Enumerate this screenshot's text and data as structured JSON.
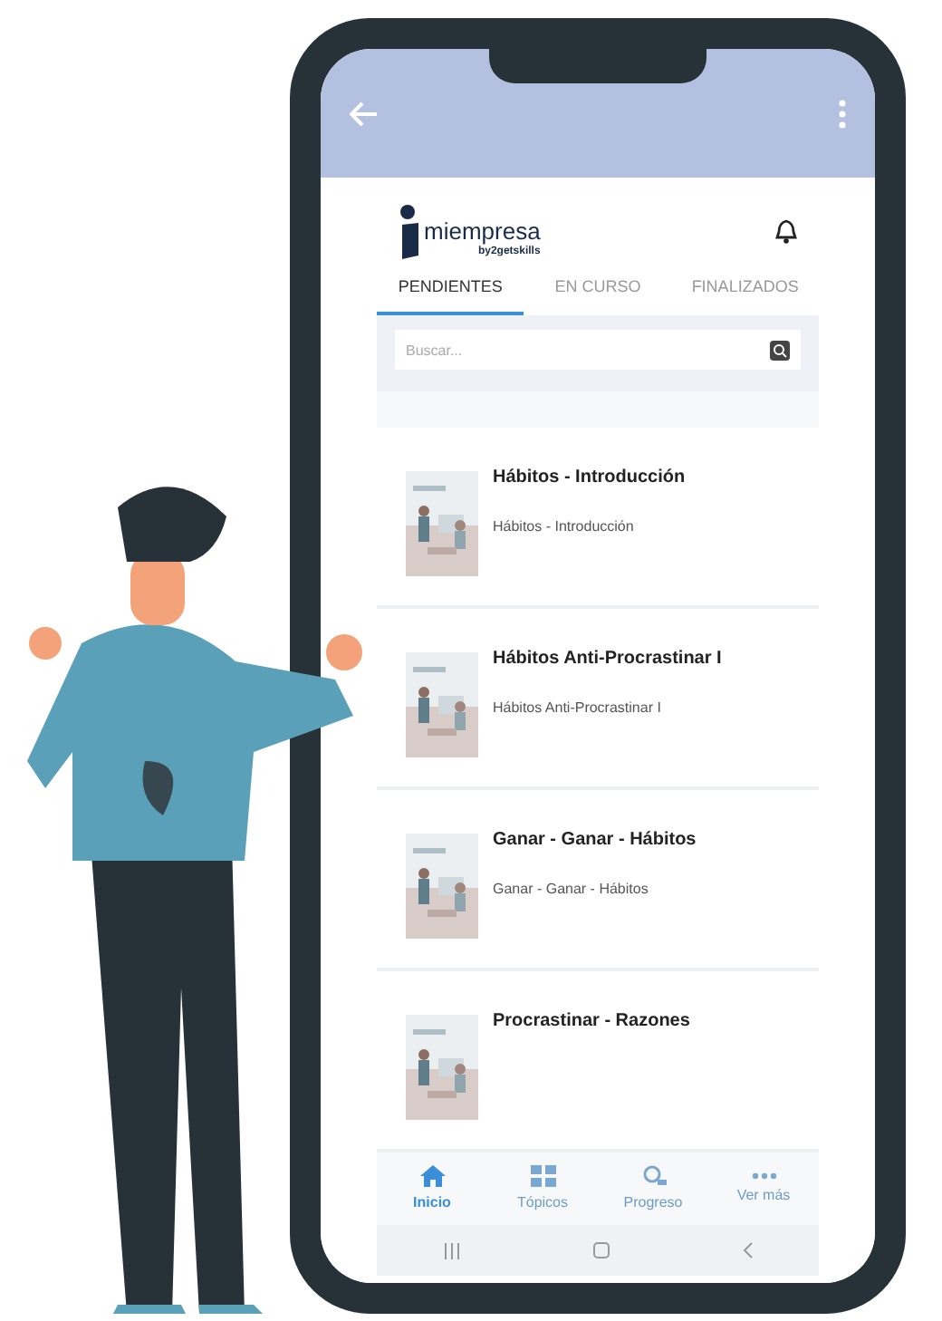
{
  "app": {
    "logo": {
      "name": "miempresa",
      "byline": "by2getskills"
    },
    "tabs": [
      {
        "label": "PENDIENTES",
        "selected": true
      },
      {
        "label": "EN CURSO",
        "selected": false
      },
      {
        "label": "FINALIZADOS",
        "selected": false
      }
    ],
    "search": {
      "placeholder": "Buscar..."
    },
    "courses": [
      {
        "title": "Hábitos - Introducción",
        "subtitle": "Hábitos - Introducción"
      },
      {
        "title": "Hábitos Anti-Procrastinar I",
        "subtitle": "Hábitos Anti-Procrastinar I"
      },
      {
        "title": "Ganar - Ganar - Hábitos",
        "subtitle": "Ganar - Ganar - Hábitos"
      },
      {
        "title": "Procrastinar  - Razones"
      }
    ],
    "bottom_nav": [
      {
        "label": "Inicio",
        "kind": "home",
        "selected": true
      },
      {
        "label": "Tópicos",
        "kind": "topics",
        "selected": false
      },
      {
        "label": "Progreso",
        "kind": "progress",
        "selected": false
      },
      {
        "label": "Ver más",
        "kind": "more",
        "selected": false
      }
    ]
  }
}
